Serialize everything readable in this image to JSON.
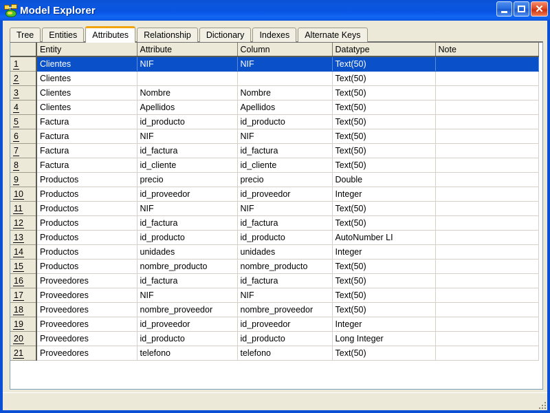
{
  "window": {
    "title": "Model Explorer",
    "icon": "model-diagram-icon",
    "caption_buttons": {
      "minimize": "minimize-button",
      "maximize": "maximize-button",
      "close": "close-button",
      "close_glyph": "✕"
    },
    "colors": {
      "titlebar_blue": "#0a52d6",
      "frame_blue": "#0a4fd4",
      "client_beige": "#ece9d8",
      "selection_blue": "#0a50c8",
      "active_tab_accent": "#f0a30a"
    }
  },
  "tabs": [
    {
      "label": "Tree",
      "active": false
    },
    {
      "label": "Entities",
      "active": false
    },
    {
      "label": "Attributes",
      "active": true
    },
    {
      "label": "Relationship",
      "active": false
    },
    {
      "label": "Dictionary",
      "active": false
    },
    {
      "label": "Indexes",
      "active": false
    },
    {
      "label": "Alternate Keys",
      "active": false
    }
  ],
  "grid": {
    "columns": [
      "",
      "Entity",
      "Attribute",
      "Column",
      "Datatype",
      "Note"
    ],
    "selected_row_index": 0,
    "rows": [
      {
        "num": "1",
        "entity": "Clientes",
        "attribute": "NIF",
        "column": "NIF",
        "datatype": "Text(50)",
        "note": ""
      },
      {
        "num": "2",
        "entity": "Clientes",
        "attribute": "",
        "column": "",
        "datatype": "Text(50)",
        "note": ""
      },
      {
        "num": "3",
        "entity": "Clientes",
        "attribute": "Nombre",
        "column": "Nombre",
        "datatype": "Text(50)",
        "note": ""
      },
      {
        "num": "4",
        "entity": "Clientes",
        "attribute": "Apellidos",
        "column": "Apellidos",
        "datatype": "Text(50)",
        "note": ""
      },
      {
        "num": "5",
        "entity": "Factura",
        "attribute": "id_producto",
        "column": "id_producto",
        "datatype": "Text(50)",
        "note": ""
      },
      {
        "num": "6",
        "entity": "Factura",
        "attribute": "NIF",
        "column": "NIF",
        "datatype": "Text(50)",
        "note": ""
      },
      {
        "num": "7",
        "entity": "Factura",
        "attribute": "id_factura",
        "column": "id_factura",
        "datatype": "Text(50)",
        "note": ""
      },
      {
        "num": "8",
        "entity": "Factura",
        "attribute": "id_cliente",
        "column": "id_cliente",
        "datatype": "Text(50)",
        "note": ""
      },
      {
        "num": "9",
        "entity": "Productos",
        "attribute": "precio",
        "column": "precio",
        "datatype": "Double",
        "note": ""
      },
      {
        "num": "10",
        "entity": "Productos",
        "attribute": "id_proveedor",
        "column": "id_proveedor",
        "datatype": "Integer",
        "note": ""
      },
      {
        "num": "11",
        "entity": "Productos",
        "attribute": "NIF",
        "column": "NIF",
        "datatype": "Text(50)",
        "note": ""
      },
      {
        "num": "12",
        "entity": "Productos",
        "attribute": "id_factura",
        "column": "id_factura",
        "datatype": "Text(50)",
        "note": ""
      },
      {
        "num": "13",
        "entity": "Productos",
        "attribute": "id_producto",
        "column": "id_producto",
        "datatype": "AutoNumber LI",
        "note": ""
      },
      {
        "num": "14",
        "entity": "Productos",
        "attribute": "unidades",
        "column": "unidades",
        "datatype": "Integer",
        "note": ""
      },
      {
        "num": "15",
        "entity": "Productos",
        "attribute": "nombre_producto",
        "column": "nombre_producto",
        "datatype": "Text(50)",
        "note": ""
      },
      {
        "num": "16",
        "entity": "Proveedores",
        "attribute": "id_factura",
        "column": "id_factura",
        "datatype": "Text(50)",
        "note": ""
      },
      {
        "num": "17",
        "entity": "Proveedores",
        "attribute": "NIF",
        "column": "NIF",
        "datatype": "Text(50)",
        "note": ""
      },
      {
        "num": "18",
        "entity": "Proveedores",
        "attribute": "nombre_proveedor",
        "column": "nombre_proveedor",
        "datatype": "Text(50)",
        "note": ""
      },
      {
        "num": "19",
        "entity": "Proveedores",
        "attribute": "id_proveedor",
        "column": "id_proveedor",
        "datatype": "Integer",
        "note": ""
      },
      {
        "num": "20",
        "entity": "Proveedores",
        "attribute": "id_producto",
        "column": "id_producto",
        "datatype": "Long Integer",
        "note": ""
      },
      {
        "num": "21",
        "entity": "Proveedores",
        "attribute": "telefono",
        "column": "telefono",
        "datatype": "Text(50)",
        "note": ""
      }
    ]
  },
  "statusbar": {
    "text": "",
    "grip": "resize-grip"
  }
}
